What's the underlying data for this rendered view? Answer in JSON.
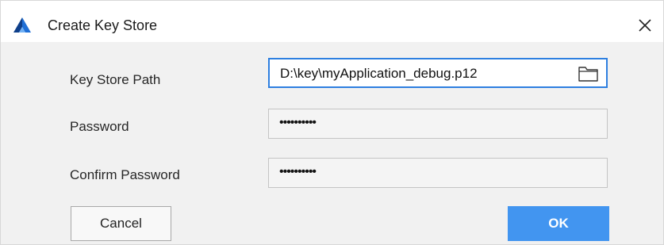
{
  "window": {
    "title": "Create Key Store",
    "app_icon": "triangle-logo-icon",
    "close_icon": "close-icon"
  },
  "form": {
    "key_store_path": {
      "label": "Key Store Path",
      "value": "D:\\key\\myApplication_debug.p12",
      "icon": "folder-icon"
    },
    "password": {
      "label": "Password",
      "value": "••••••••••"
    },
    "confirm_password": {
      "label": "Confirm Password",
      "value": "••••••••••"
    }
  },
  "buttons": {
    "cancel_label": "Cancel",
    "ok_label": "OK"
  },
  "colors": {
    "accent": "#4295f0",
    "focus_border": "#2e7fe0",
    "logo_blue": "#1f6fd6",
    "logo_dark": "#0e3f8a"
  }
}
